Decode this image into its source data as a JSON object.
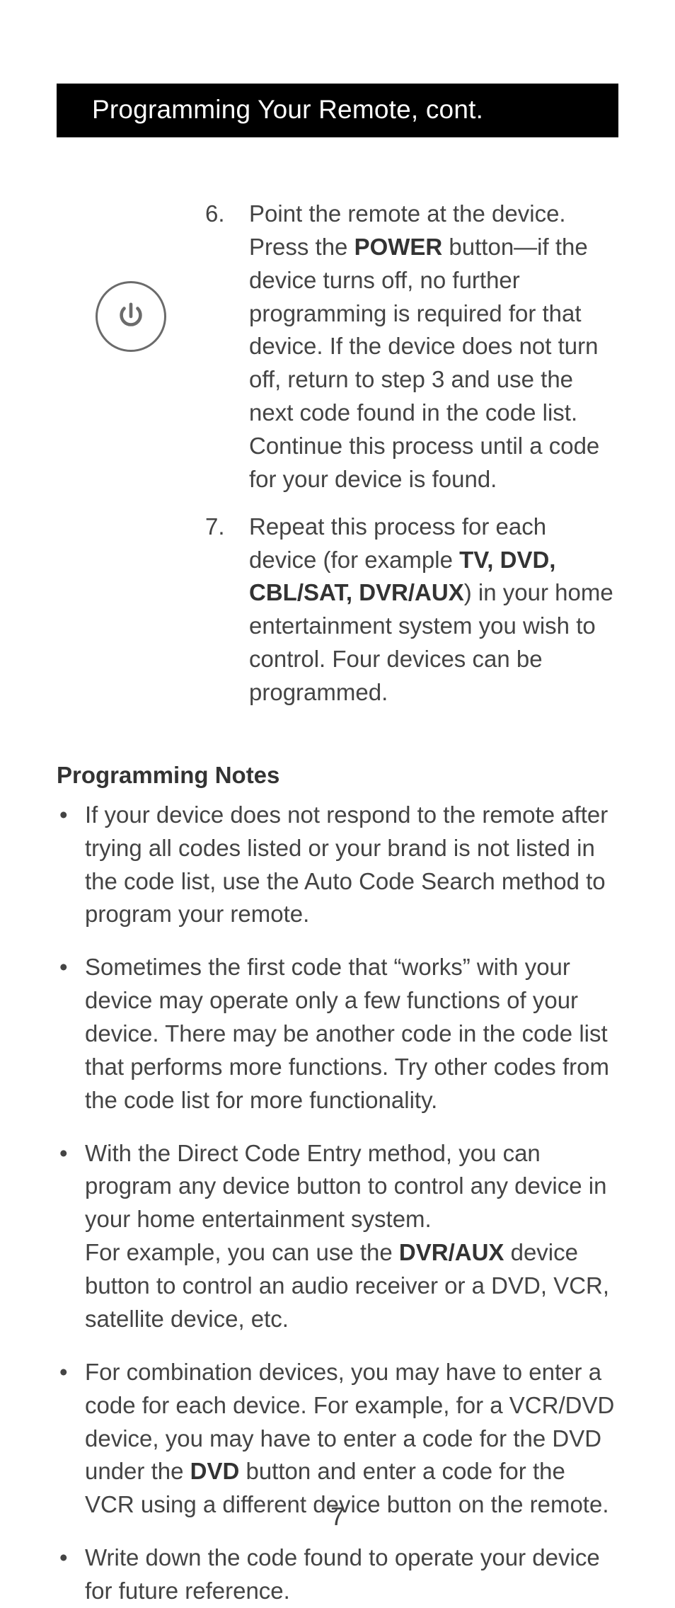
{
  "header": {
    "title": "Programming Your Remote, cont."
  },
  "icons": {
    "power": "power-icon"
  },
  "steps": [
    {
      "num": "6.",
      "pre": "Point the remote at the device. Press the ",
      "b1": "POWER",
      "post": " button—if the device turns off, no further programming is required for that device. If the device does not turn off, return to step 3 and use the next code found in the code list. Continue this process until a code for your device is found."
    },
    {
      "num": "7.",
      "pre": "Repeat this process for each device (for example ",
      "b1": "TV, DVD, CBL/SAT, DVR/AUX",
      "post": ") in your home entertainment system you wish to control. Four devices can be programmed."
    }
  ],
  "notes_heading": "Programming Notes",
  "notes": [
    {
      "a": "If your device does not respond to the remote after trying all codes listed or your brand is not listed in the code list, use the Auto Code Search method to program your remote."
    },
    {
      "a": "Sometimes the first code that “works” with your device may operate only a few functions of your device. There may be another code in the code list that performs more functions. Try other codes from the code list for more functionality."
    },
    {
      "a": "With the Direct Code Entry method, you can program any device button to control any device in your home entertainment system.",
      "br": true,
      "b": "For example, you can use the ",
      "bold": "DVR/AUX",
      "c": " device button to control an audio receiver or a DVD, VCR, satellite device, etc."
    },
    {
      "a": "For combination devices, you may have to enter a code for each device. For example, for a VCR/DVD device, you may have to enter a code for the DVD under the ",
      "bold": "DVD",
      "c": " button and enter a code for the VCR using a different device button on the remote."
    },
    {
      "a": "Write down the code found to operate your device for future reference."
    }
  ],
  "page_number": "7"
}
